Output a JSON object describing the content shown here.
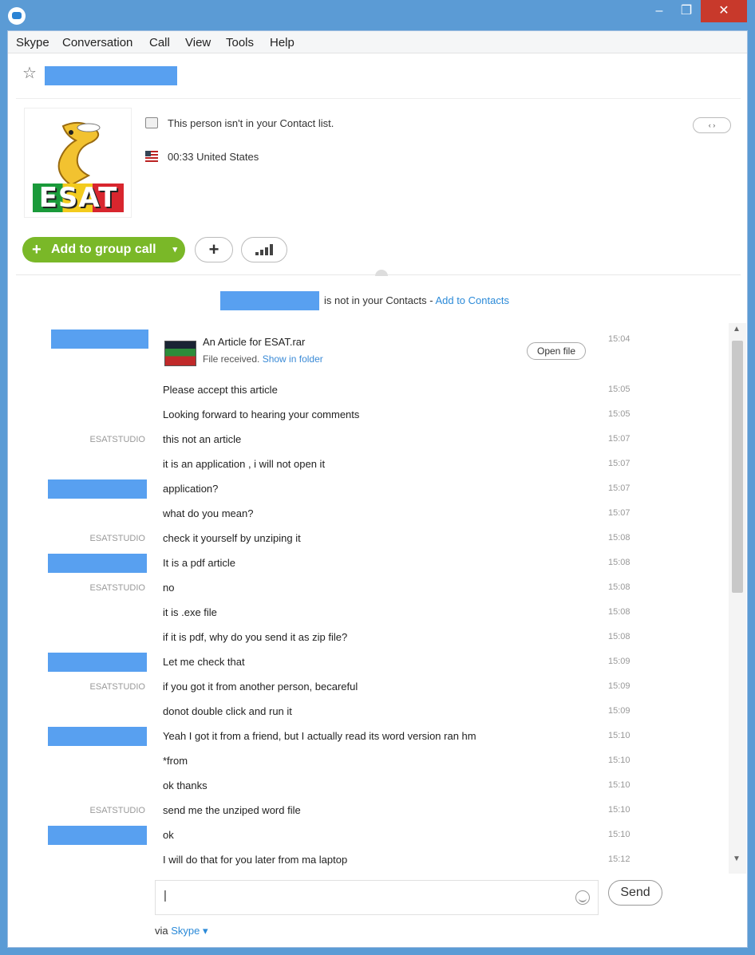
{
  "window": {
    "minimize_glyph": "–",
    "maximize_glyph": "❐",
    "close_glyph": "✕"
  },
  "menu": [
    "Skype",
    "Conversation",
    "Call",
    "View",
    "Tools",
    "Help"
  ],
  "profile": {
    "logo_text": "ESAT",
    "contact_status": "This person isn't in your Contact list.",
    "phone_location": "00:33 United States",
    "nav_label": "‹ ›"
  },
  "actions": {
    "group_call_label": "Add to group call",
    "add_label": "+"
  },
  "notice": {
    "text": "is not in your Contacts - ",
    "link": "Add to Contacts"
  },
  "file_transfer": {
    "name": "An Article for ESAT.rar",
    "status_prefix": "File received. ",
    "status_link": "Show in folder",
    "open_label": "Open file",
    "time": "15:04"
  },
  "messages": [
    {
      "sender": "",
      "text": "Please accept this article",
      "time": "15:05"
    },
    {
      "sender": "",
      "text": "Looking forward to hearing your comments",
      "time": "15:05"
    },
    {
      "sender": "ESATSTUDIO",
      "text": "this not an article",
      "time": "15:07"
    },
    {
      "sender": "",
      "text": "it is an application , i will not open it",
      "time": "15:07"
    },
    {
      "sender": "redacted",
      "text": "application?",
      "time": "15:07"
    },
    {
      "sender": "",
      "text": "what do you mean?",
      "time": "15:07"
    },
    {
      "sender": "ESATSTUDIO",
      "text": "check it yourself by unziping it",
      "time": "15:08"
    },
    {
      "sender": "redacted",
      "text": "It is a pdf article",
      "time": "15:08"
    },
    {
      "sender": "ESATSTUDIO",
      "text": "no",
      "time": "15:08"
    },
    {
      "sender": "",
      "text": "it is .exe file",
      "time": "15:08"
    },
    {
      "sender": "",
      "text": "if it is pdf, why do you send it as zip file?",
      "time": "15:08"
    },
    {
      "sender": "redacted",
      "text": "Let me check that",
      "time": "15:09"
    },
    {
      "sender": "ESATSTUDIO",
      "text": "if you got it from another person, becareful",
      "time": "15:09"
    },
    {
      "sender": "",
      "text": "donot double click and run it",
      "time": "15:09"
    },
    {
      "sender": "redacted",
      "text": "Yeah I got it from a friend, but I actually read its word version ran hm",
      "time": "15:10"
    },
    {
      "sender": "",
      "text": "*from",
      "time": "15:10"
    },
    {
      "sender": "",
      "text": "ok thanks",
      "time": "15:10"
    },
    {
      "sender": "ESATSTUDIO",
      "text": "send me the unziped word file",
      "time": "15:10"
    },
    {
      "sender": "redacted",
      "text": "ok",
      "time": "15:10"
    },
    {
      "sender": "",
      "text": "I will do that for you later from ma laptop",
      "time": "15:12"
    }
  ],
  "composer": {
    "value": "|",
    "send_label": "Send",
    "via_prefix": "via ",
    "via_link": "Skype ▾"
  },
  "colors": {
    "titlebar": "#5b9bd5",
    "accent_green": "#7ab828",
    "link_blue": "#2b8ad8",
    "redaction": "#58a0f0"
  }
}
